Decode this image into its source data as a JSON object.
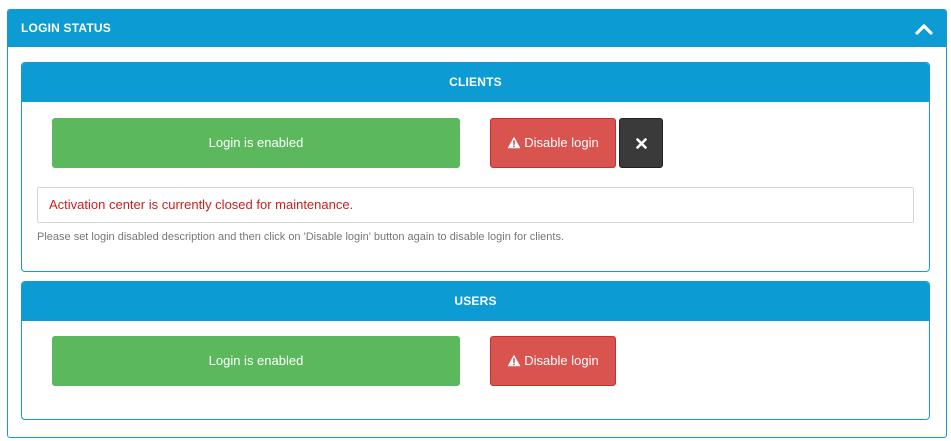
{
  "outer": {
    "title": "LOGIN STATUS"
  },
  "clients": {
    "title": "CLIENTS",
    "status_label": "Login is enabled",
    "disable_label": "Disable login",
    "description_value": "Activation center is currently closed for maintenance.",
    "help_text": "Please set login disabled description and then click on 'Disable login' button again to disable login for clients."
  },
  "users": {
    "title": "USERS",
    "status_label": "Login is enabled",
    "disable_label": "Disable login"
  },
  "icons": {
    "collapse": "chevron-up-icon",
    "warning": "warning-icon",
    "close": "close-icon"
  },
  "colors": {
    "header_blue": "#0c9bd3",
    "success_green": "#5cb85c",
    "danger_red": "#d9534f",
    "dark_button": "#3a3a3a",
    "error_text": "#cc1f1a"
  }
}
